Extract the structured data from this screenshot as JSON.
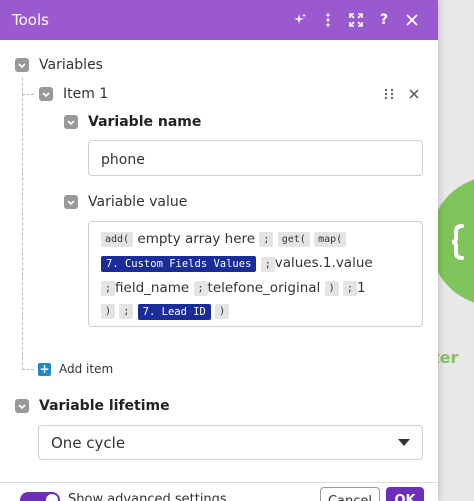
{
  "header": {
    "title": "Tools"
  },
  "variables": {
    "label": "Variables",
    "item_label": "Item 1",
    "variable_name_label": "Variable name",
    "variable_name_value": "phone",
    "variable_value_label": "Variable value",
    "value_tokens": {
      "t1": "add(",
      "t2": "empty array here",
      "t3": ";",
      "t4": "get(",
      "t5": "map(",
      "t6": "7. Custom Fields Values",
      "t7": ";",
      "t8": "values.1.value",
      "t9": ";",
      "t10": "field_name",
      "t11": ";",
      "t12": "telefone_original",
      "t13": ")",
      "t14": ";",
      "t15": "1",
      "t16": ")",
      "t17": ";",
      "t18": "7. Lead ID",
      "t19": ")"
    },
    "add_item_label": "Add item"
  },
  "lifetime": {
    "label": "Variable lifetime",
    "selected": "One cycle"
  },
  "footer": {
    "advanced_label": "Show advanced settings",
    "cancel_label": "Cancel",
    "ok_label": "OK"
  },
  "background_module": {
    "label": "Iter"
  },
  "colors": {
    "header": "#9b59d0",
    "variable_token": "#1a2c9a",
    "module": "#7fc45a",
    "primary": "#6d2fb8"
  }
}
